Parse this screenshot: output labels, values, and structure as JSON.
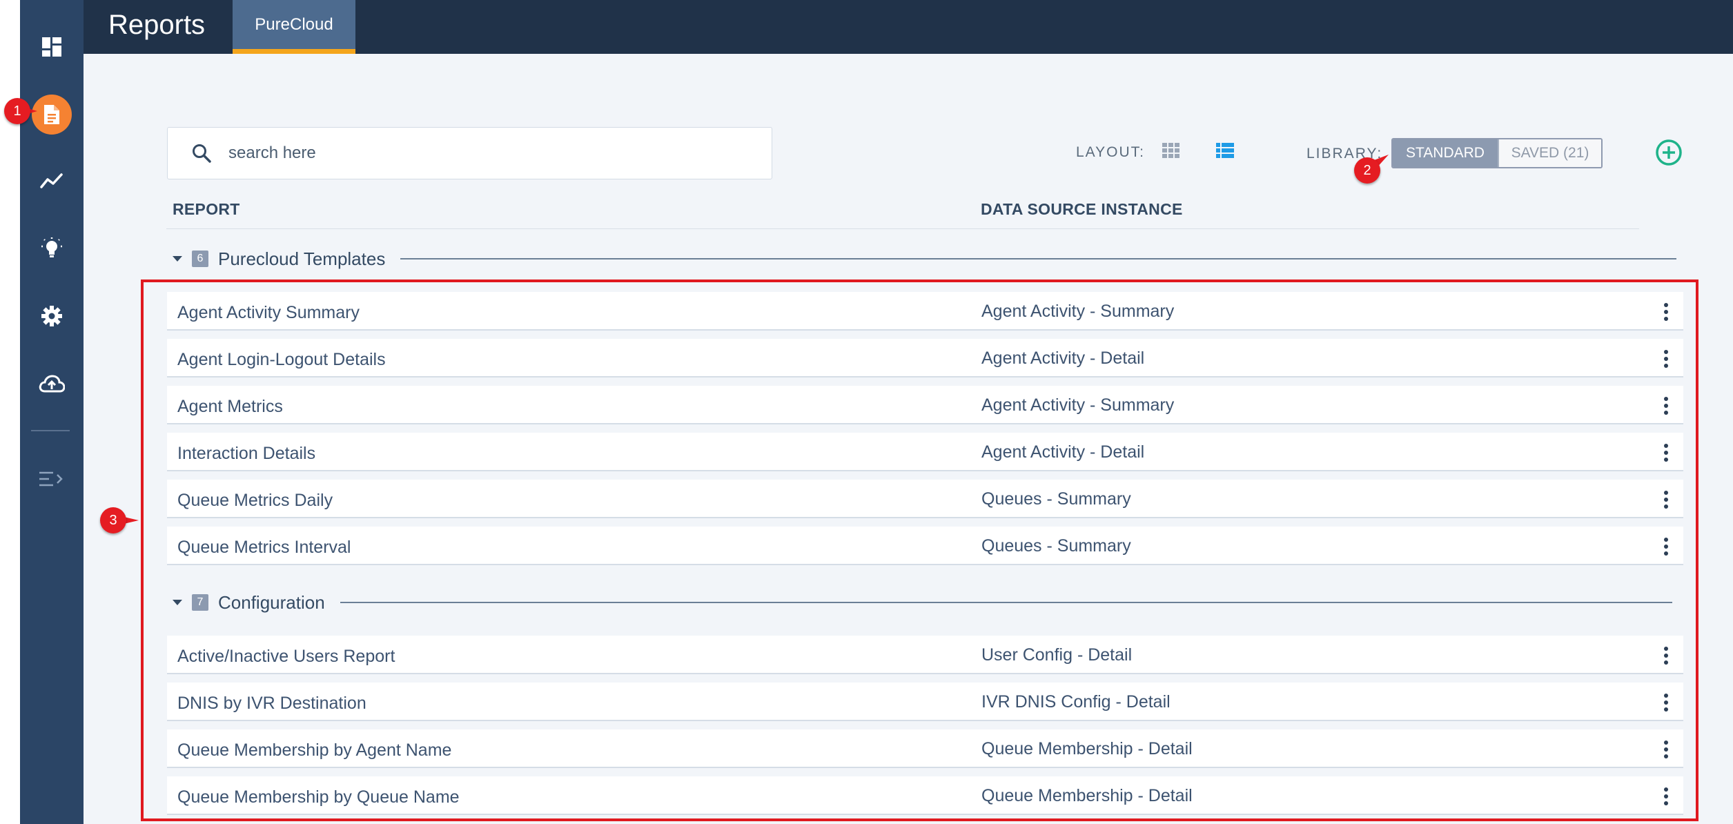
{
  "app": {
    "title": "Reports"
  },
  "tabs": [
    {
      "label": "PureCloud",
      "active": true
    }
  ],
  "sidebar": {
    "items": [
      {
        "icon": "dashboard-icon"
      },
      {
        "icon": "report-document-icon",
        "active": true
      },
      {
        "icon": "trend-line-icon"
      },
      {
        "icon": "lightbulb-icon"
      },
      {
        "icon": "gear-icon"
      },
      {
        "icon": "cloud-upload-icon"
      },
      {
        "icon": "collapse-menu-icon"
      }
    ]
  },
  "search": {
    "placeholder": "search here"
  },
  "toolbar": {
    "layout_label": "LAYOUT:",
    "library_label": "LIBRARY:",
    "standard_label": "STANDARD",
    "saved_label": "SAVED (21)",
    "add_icon": "plus-circle-icon"
  },
  "columns": {
    "report": "REPORT",
    "source": "DATA SOURCE INSTANCE"
  },
  "groups": [
    {
      "title": "Purecloud Templates",
      "count": "6",
      "rows": [
        {
          "name": "Agent Activity Summary",
          "source": "Agent Activity - Summary"
        },
        {
          "name": "Agent Login-Logout Details",
          "source": "Agent Activity - Detail"
        },
        {
          "name": "Agent Metrics",
          "source": "Agent Activity - Summary"
        },
        {
          "name": "Interaction Details",
          "source": "Agent Activity - Detail"
        },
        {
          "name": "Queue Metrics Daily",
          "source": "Queues - Summary"
        },
        {
          "name": "Queue Metrics Interval",
          "source": "Queues - Summary"
        }
      ]
    },
    {
      "title": "Configuration",
      "count": "7",
      "rows": [
        {
          "name": "Active/Inactive Users Report",
          "source": "User Config - Detail"
        },
        {
          "name": "DNIS by IVR Destination",
          "source": "IVR DNIS Config - Detail"
        },
        {
          "name": "Queue Membership by Agent Name",
          "source": "Queue Membership - Detail"
        },
        {
          "name": "Queue Membership by Queue Name",
          "source": "Queue Membership - Detail"
        }
      ]
    }
  ],
  "callouts": [
    "1",
    "2",
    "3"
  ],
  "colors": {
    "sidebar": "#2b4566",
    "topbar": "#203249",
    "tab_active": "#4d6b8f",
    "tab_underline": "#f4a51c",
    "active_icon_bg": "#f58232",
    "add_button": "#1fb38a",
    "highlight": "#e0191f"
  }
}
